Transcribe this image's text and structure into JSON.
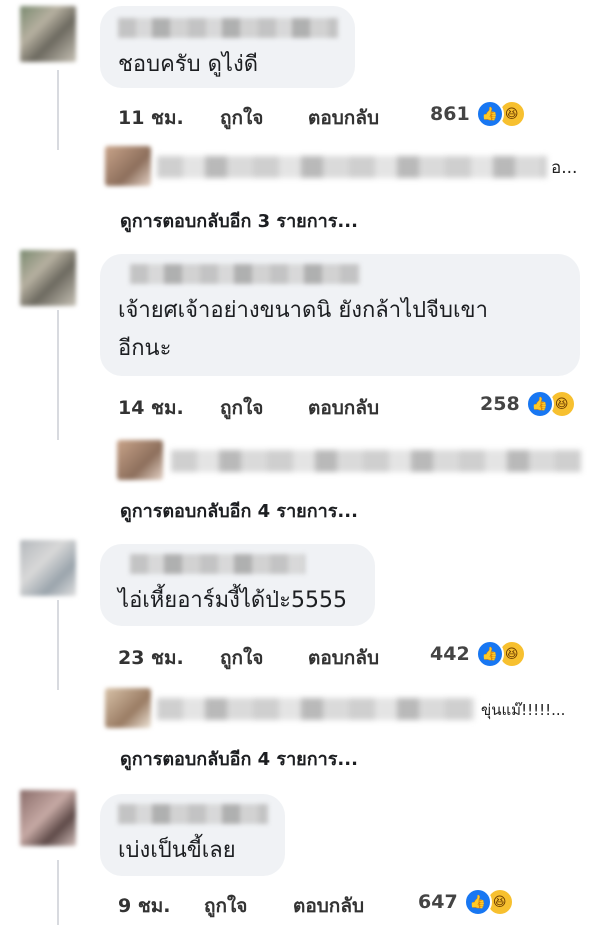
{
  "comments": [
    {
      "text_lines": [
        "ชอบครับ ดูไง่ดี"
      ],
      "time": "11 ชม.",
      "like": "ถูกใจ",
      "reply": "ตอบกลับ",
      "reaction_count": "861",
      "reply_preview_tail": "อ...",
      "more_replies": "ดูการตอบกลับอีก 3 รายการ..."
    },
    {
      "text_lines": [
        "เจ้ายศเจ้าอย่างขนาดนิ ยังกล้าไปจีบเขา",
        "อีกนะ"
      ],
      "time": "14 ชม.",
      "like": "ถูกใจ",
      "reply": "ตอบกลับ",
      "reaction_count": "258",
      "reply_preview_tail": "",
      "more_replies": "ดูการตอบกลับอีก 4 รายการ..."
    },
    {
      "text_lines": [
        "ไอ่เหี้ยอาร์มงี้ได้ป่ะ5555"
      ],
      "time": "23 ชม.",
      "like": "ถูกใจ",
      "reply": "ตอบกลับ",
      "reaction_count": "442",
      "reply_preview_tail": "ขุ่นแม๊!!!!!...",
      "more_replies": "ดูการตอบกลับอีก 4 รายการ..."
    },
    {
      "text_lines": [
        "เบ่งเป็นขี้เลย"
      ],
      "time": "9 ชม.",
      "like": "ถูกใจ",
      "reply": "ตอบกลับ",
      "reaction_count": "647"
    }
  ],
  "icons": {
    "like": "like-icon",
    "haha": "haha-icon"
  },
  "colors": {
    "like": "#1877f2",
    "haha": "#f7c02f",
    "bubble": "#f0f2f5"
  }
}
